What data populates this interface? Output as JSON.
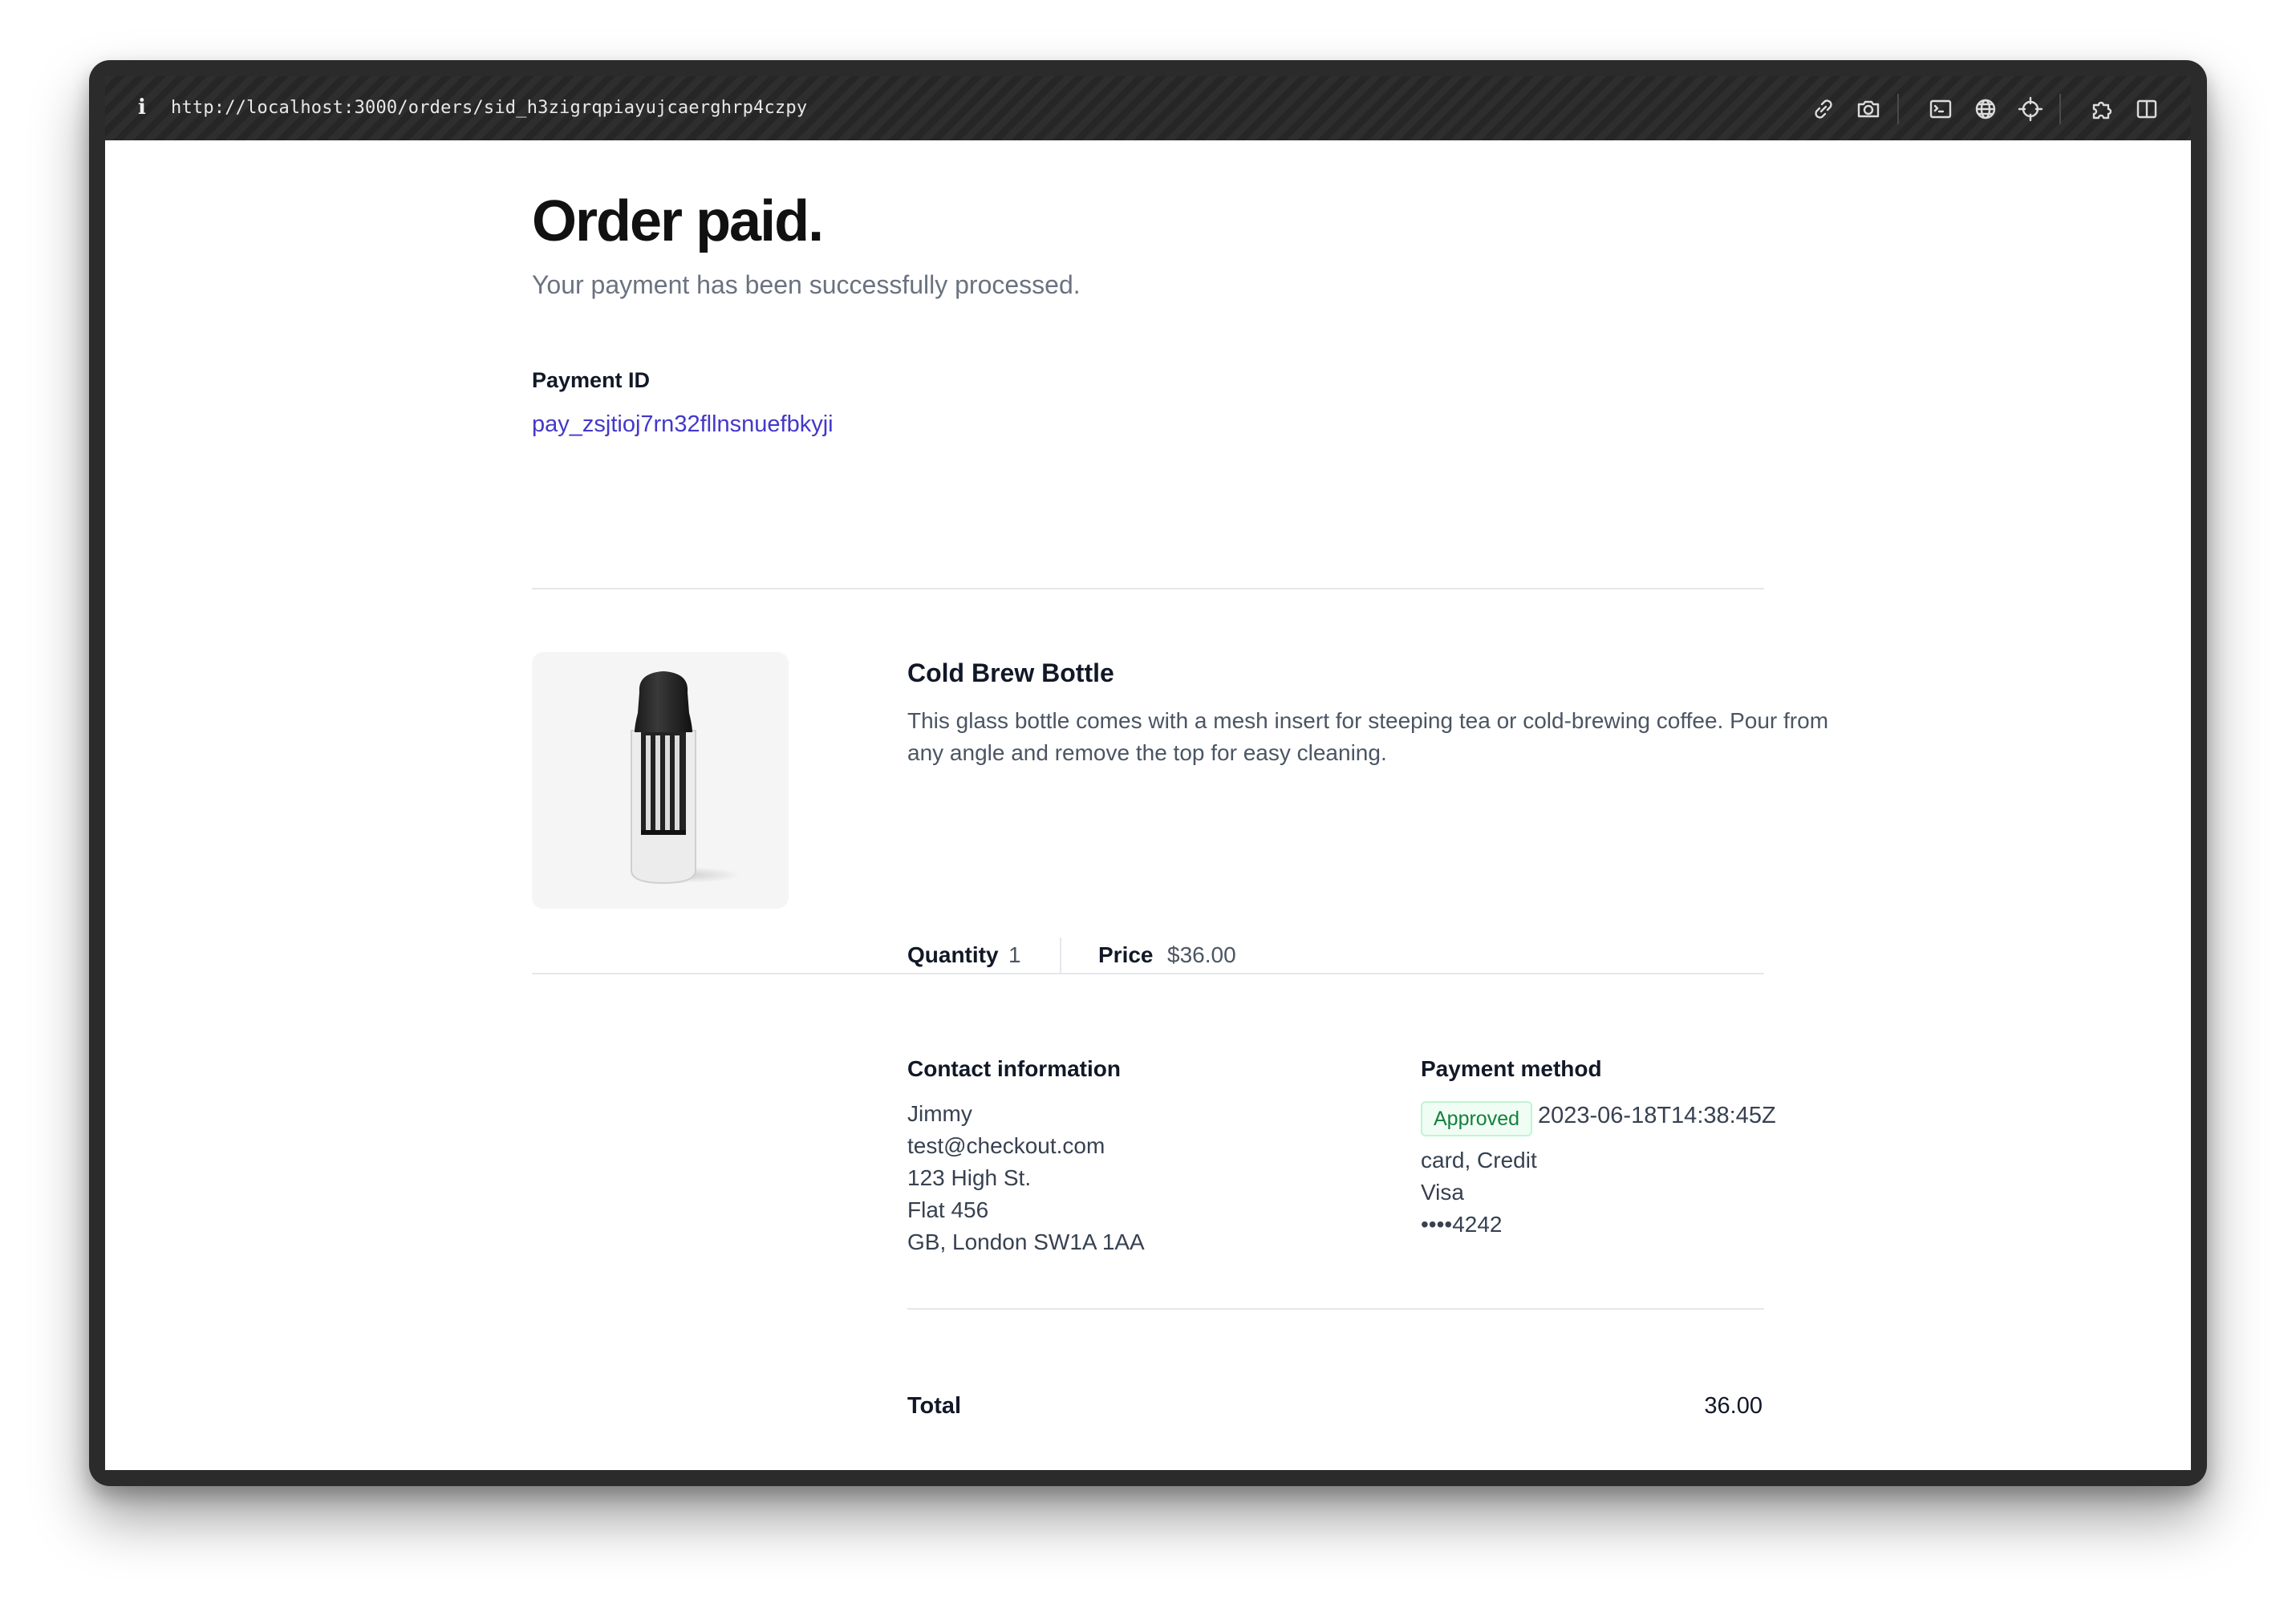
{
  "browser": {
    "url": "http://localhost:3000/orders/sid_h3zigrqpiayujcaerghrp4czpy",
    "info_icon": "info-icon",
    "toolbar_icons": [
      "link-icon",
      "camera-icon",
      "terminal-icon",
      "globe-icon",
      "crosshair-icon",
      "extension-icon",
      "sidebar-icon"
    ]
  },
  "page": {
    "title": "Order paid.",
    "subtitle": "Your payment has been successfully processed.",
    "payment_id_label": "Payment ID",
    "payment_id": "pay_zsjtioj7rn32fllnsnuefbkyji"
  },
  "product": {
    "name": "Cold Brew Bottle",
    "description": "This glass bottle comes with a mesh insert for steeping tea or cold-brewing coffee. Pour from any angle and remove the top for easy cleaning.",
    "quantity_label": "Quantity",
    "quantity": "1",
    "price_label": "Price",
    "price": "$36.00"
  },
  "contact": {
    "label": "Contact information",
    "lines": [
      "Jimmy",
      "test@checkout.com",
      "123 High St.",
      "Flat 456",
      "GB, London SW1A 1AA"
    ]
  },
  "payment": {
    "label": "Payment method",
    "status": "Approved",
    "date": "2023-06-18T14:38:45Z",
    "lines": [
      "card, Credit",
      "Visa",
      "••••4242"
    ]
  },
  "total": {
    "label": "Total",
    "value": "36.00"
  },
  "colors": {
    "link": "#4338ca",
    "badge_text": "#15803d",
    "badge_bg": "#f0fdf4"
  }
}
